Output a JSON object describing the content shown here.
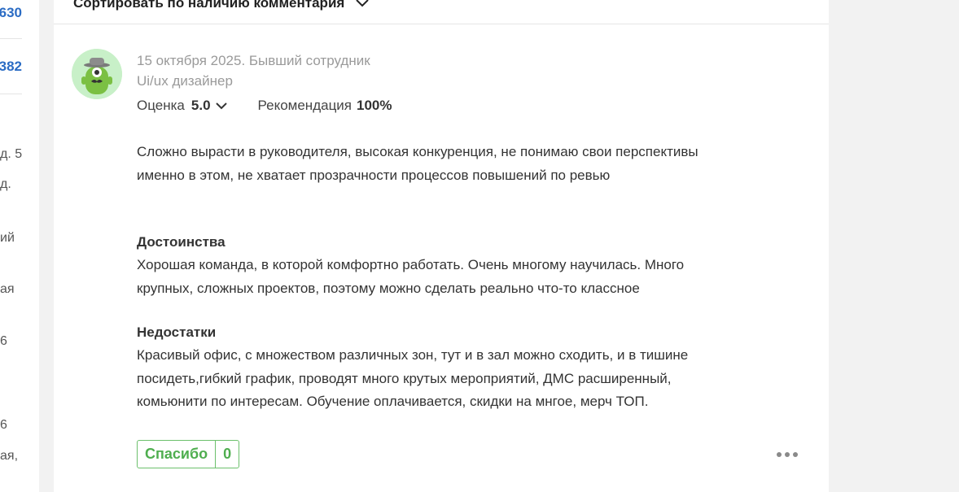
{
  "left_column": {
    "numbers": [
      "630",
      "382"
    ],
    "fragments": [
      "д. 5",
      "д.",
      "ий",
      "ая",
      "6",
      "6",
      "ая,"
    ]
  },
  "sort": {
    "label": "Сортировать по наличию комментария"
  },
  "review": {
    "date_status": "15 октября 2025. Бывший сотрудник",
    "position": "Ui/ux дизайнер",
    "rating_label": "Оценка",
    "rating_value": "5.0",
    "recommend_label": "Рекомендация",
    "recommend_value": "100%",
    "summary": "Сложно вырасти в руководителя, высокая конкуренция, не понимаю свои перспективы именно в этом, не хватает прозрачности процессов повышений по ревью",
    "pros_title": "Достоинства",
    "pros_text": "Хорошая команда, в которой комфортно работать. Очень многому научилась. Много крупных, сложных проектов, поэтому можно сделать реально что-то классное",
    "cons_title": "Недостатки",
    "cons_text": "Красивый офис, с множеством различных зон, тут и в зал можно сходить, и в тишине посидеть,гибкий график, проводят много крутых мероприятий, ДМС расширенный, комьюнити по интересам. Обучение оплачивается, скидки на мнгое, мерч ТОП.",
    "thanks_label": "Спасибо",
    "thanks_count": "0"
  },
  "icons": {
    "sort_chevron": "chevron-down-icon",
    "rating_chevron": "chevron-down-icon",
    "more": "more-dots-icon",
    "avatar": "avatar-icon"
  },
  "colors": {
    "link_blue": "#2b6cc4",
    "thanks_green": "#4fae4f",
    "avatar_bg": "#c8f0c8",
    "meta_gray": "#9a9a9a"
  }
}
